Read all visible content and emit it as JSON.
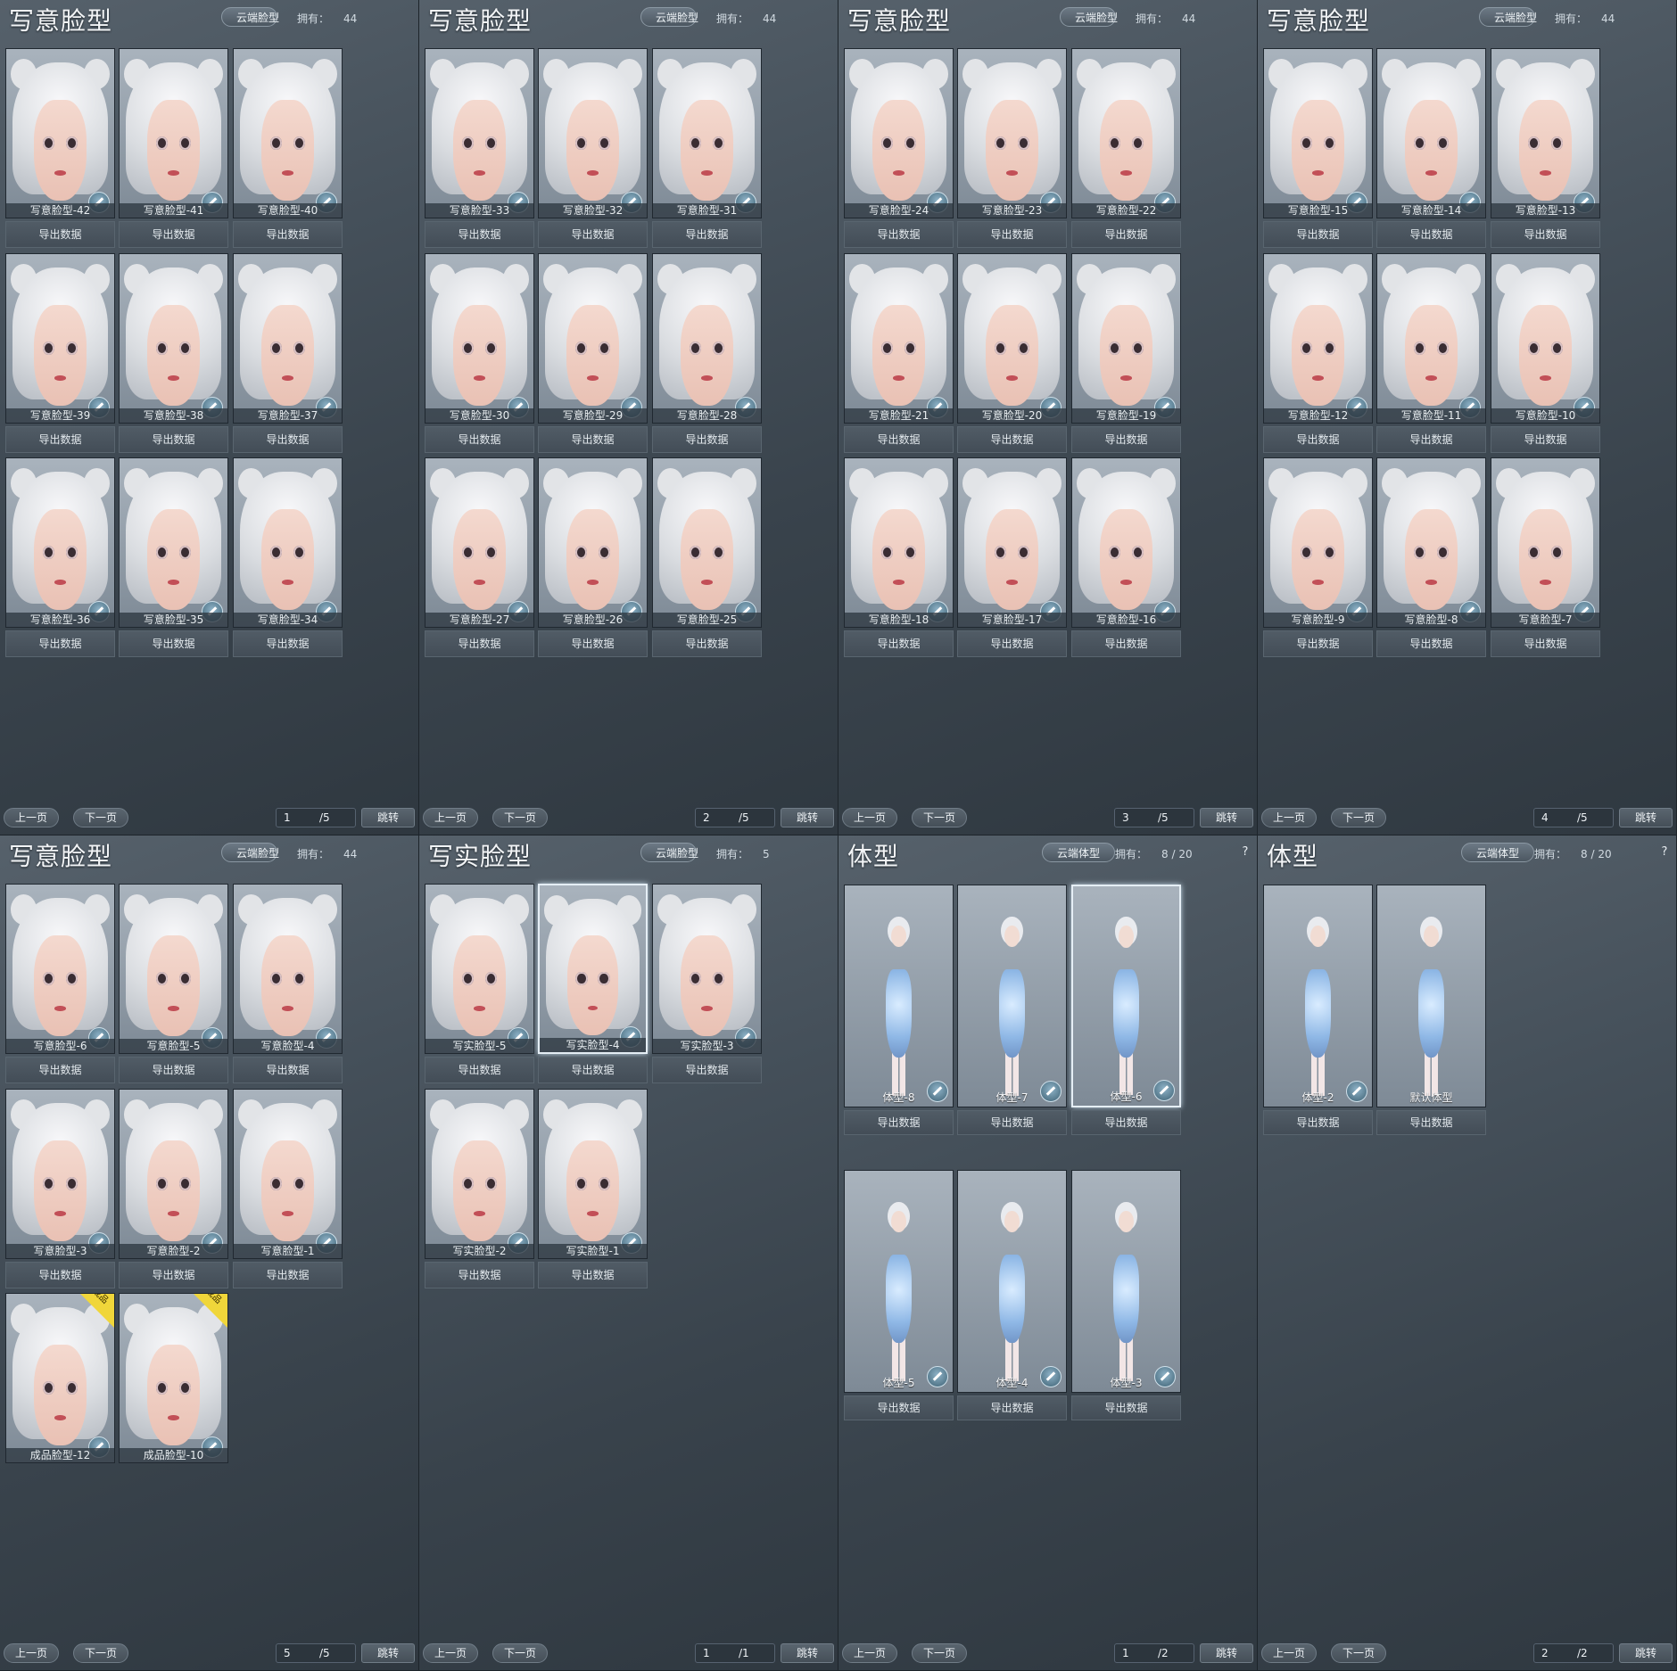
{
  "panels": [
    {
      "title": "写意脸型",
      "cloud_label": "云端脸型",
      "owned_label": "拥有：",
      "owned_value": "44",
      "kind": "face",
      "items": [
        {
          "name": "写意脸型-42",
          "export": "导出数据"
        },
        {
          "name": "写意脸型-41",
          "export": "导出数据"
        },
        {
          "name": "写意脸型-40",
          "export": "导出数据"
        },
        {
          "name": "写意脸型-39",
          "export": "导出数据"
        },
        {
          "name": "写意脸型-38",
          "export": "导出数据"
        },
        {
          "name": "写意脸型-37",
          "export": "导出数据"
        },
        {
          "name": "写意脸型-36",
          "export": "导出数据"
        },
        {
          "name": "写意脸型-35",
          "export": "导出数据"
        },
        {
          "name": "写意脸型-34",
          "export": "导出数据"
        }
      ],
      "pager": {
        "prev": "上一页",
        "next": "下一页",
        "page": "1",
        "total": "/5",
        "jump": "跳转"
      }
    },
    {
      "title": "写意脸型",
      "cloud_label": "云端脸型",
      "owned_label": "拥有：",
      "owned_value": "44",
      "kind": "face",
      "items": [
        {
          "name": "写意脸型-33",
          "export": "导出数据"
        },
        {
          "name": "写意脸型-32",
          "export": "导出数据"
        },
        {
          "name": "写意脸型-31",
          "export": "导出数据"
        },
        {
          "name": "写意脸型-30",
          "export": "导出数据"
        },
        {
          "name": "写意脸型-29",
          "export": "导出数据"
        },
        {
          "name": "写意脸型-28",
          "export": "导出数据"
        },
        {
          "name": "写意脸型-27",
          "export": "导出数据"
        },
        {
          "name": "写意脸型-26",
          "export": "导出数据"
        },
        {
          "name": "写意脸型-25",
          "export": "导出数据"
        }
      ],
      "pager": {
        "prev": "上一页",
        "next": "下一页",
        "page": "2",
        "total": "/5",
        "jump": "跳转"
      }
    },
    {
      "title": "写意脸型",
      "cloud_label": "云端脸型",
      "owned_label": "拥有：",
      "owned_value": "44",
      "kind": "face",
      "items": [
        {
          "name": "写意脸型-24",
          "export": "导出数据"
        },
        {
          "name": "写意脸型-23",
          "export": "导出数据"
        },
        {
          "name": "写意脸型-22",
          "export": "导出数据"
        },
        {
          "name": "写意脸型-21",
          "export": "导出数据"
        },
        {
          "name": "写意脸型-20",
          "export": "导出数据"
        },
        {
          "name": "写意脸型-19",
          "export": "导出数据"
        },
        {
          "name": "写意脸型-18",
          "export": "导出数据"
        },
        {
          "name": "写意脸型-17",
          "export": "导出数据"
        },
        {
          "name": "写意脸型-16",
          "export": "导出数据"
        }
      ],
      "pager": {
        "prev": "上一页",
        "next": "下一页",
        "page": "3",
        "total": "/5",
        "jump": "跳转"
      }
    },
    {
      "title": "写意脸型",
      "cloud_label": "云端脸型",
      "owned_label": "拥有：",
      "owned_value": "44",
      "kind": "face",
      "items": [
        {
          "name": "写意脸型-15",
          "export": "导出数据"
        },
        {
          "name": "写意脸型-14",
          "export": "导出数据"
        },
        {
          "name": "写意脸型-13",
          "export": "导出数据"
        },
        {
          "name": "写意脸型-12",
          "export": "导出数据"
        },
        {
          "name": "写意脸型-11",
          "export": "导出数据"
        },
        {
          "name": "写意脸型-10",
          "export": "导出数据"
        },
        {
          "name": "写意脸型-9",
          "export": "导出数据"
        },
        {
          "name": "写意脸型-8",
          "export": "导出数据"
        },
        {
          "name": "写意脸型-7",
          "export": "导出数据"
        }
      ],
      "pager": {
        "prev": "上一页",
        "next": "下一页",
        "page": "4",
        "total": "/5",
        "jump": "跳转"
      }
    },
    {
      "title": "写意脸型",
      "cloud_label": "云端脸型",
      "owned_label": "拥有：",
      "owned_value": "44",
      "kind": "face",
      "items": [
        {
          "name": "写意脸型-6",
          "export": "导出数据"
        },
        {
          "name": "写意脸型-5",
          "export": "导出数据"
        },
        {
          "name": "写意脸型-4",
          "export": "导出数据"
        },
        {
          "name": "写意脸型-3",
          "export": "导出数据"
        },
        {
          "name": "写意脸型-2",
          "export": "导出数据"
        },
        {
          "name": "写意脸型-1",
          "export": "导出数据"
        },
        {
          "name": "成品脸型-12",
          "badge": "成品"
        },
        {
          "name": "成品脸型-10",
          "badge": "成品"
        }
      ],
      "pager": {
        "prev": "上一页",
        "next": "下一页",
        "page": "5",
        "total": "/5",
        "jump": "跳转"
      }
    },
    {
      "title": "写实脸型",
      "cloud_label": "云端脸型",
      "owned_label": "拥有：",
      "owned_value": "5",
      "kind": "face",
      "items": [
        {
          "name": "写实脸型-5",
          "export": "导出数据"
        },
        {
          "name": "写实脸型-4",
          "export": "导出数据",
          "selected": true
        },
        {
          "name": "写实脸型-3",
          "export": "导出数据"
        },
        {
          "name": "写实脸型-2",
          "export": "导出数据"
        },
        {
          "name": "写实脸型-1",
          "export": "导出数据"
        }
      ],
      "pager": {
        "prev": "上一页",
        "next": "下一页",
        "page": "1",
        "total": "/1",
        "jump": "跳转"
      }
    },
    {
      "title": "体型",
      "cloud_label": "云端体型",
      "owned_label": "拥有：",
      "owned_value": "8 / 20",
      "help": "?",
      "kind": "body",
      "items": [
        {
          "name": "体型-8",
          "export": "导出数据"
        },
        {
          "name": "体型-7",
          "export": "导出数据"
        },
        {
          "name": "体型-6",
          "export": "导出数据",
          "selected": true
        },
        {
          "name": "体型-5",
          "export": "导出数据"
        },
        {
          "name": "体型-4",
          "export": "导出数据"
        },
        {
          "name": "体型-3",
          "export": "导出数据"
        }
      ],
      "pager": {
        "prev": "上一页",
        "next": "下一页",
        "page": "1",
        "total": "/2",
        "jump": "跳转"
      }
    },
    {
      "title": "体型",
      "cloud_label": "云端体型",
      "owned_label": "拥有：",
      "owned_value": "8 / 20",
      "help": "?",
      "kind": "body",
      "items": [
        {
          "name": "体型-2",
          "export": "导出数据"
        },
        {
          "name": "默认体型",
          "export": "导出数据",
          "no_edit": true
        }
      ],
      "pager": {
        "prev": "上一页",
        "next": "下一页",
        "page": "2",
        "total": "/2",
        "jump": "跳转"
      }
    }
  ]
}
